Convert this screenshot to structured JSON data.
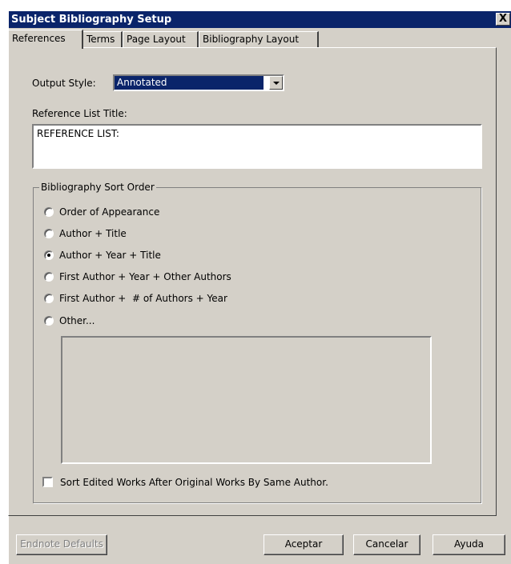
{
  "window": {
    "title": "Subject Bibliography Setup",
    "close_glyph": "X"
  },
  "tabs": [
    {
      "label": "References",
      "active": true
    },
    {
      "label": "Terms",
      "active": false
    },
    {
      "label": "Page Layout",
      "active": false
    },
    {
      "label": "Bibliography Layout",
      "active": false
    }
  ],
  "output_style": {
    "label": "Output Style:",
    "value": "Annotated"
  },
  "reference_list_title": {
    "label": "Reference List Title:",
    "value": "REFERENCE LIST:"
  },
  "sort_order": {
    "group_label": "Bibliography Sort Order",
    "options": [
      {
        "label": "Order of Appearance",
        "selected": false
      },
      {
        "label": "Author + Title",
        "selected": false
      },
      {
        "label": "Author + Year + Title",
        "selected": true
      },
      {
        "label": "First Author + Year + Other Authors",
        "selected": false
      },
      {
        "label": "First Author +  # of Authors + Year",
        "selected": false
      },
      {
        "label": "Other...",
        "selected": false
      }
    ],
    "checkbox": {
      "label": "Sort Edited Works After Original Works By Same Author.",
      "checked": false
    }
  },
  "buttons": {
    "defaults": "Endnote Defaults",
    "ok": "Aceptar",
    "cancel": "Cancelar",
    "help": "Ayuda"
  },
  "colors": {
    "face": "#d4d0c8",
    "titlebar": "#0a246a",
    "selection": "#0a246a"
  }
}
